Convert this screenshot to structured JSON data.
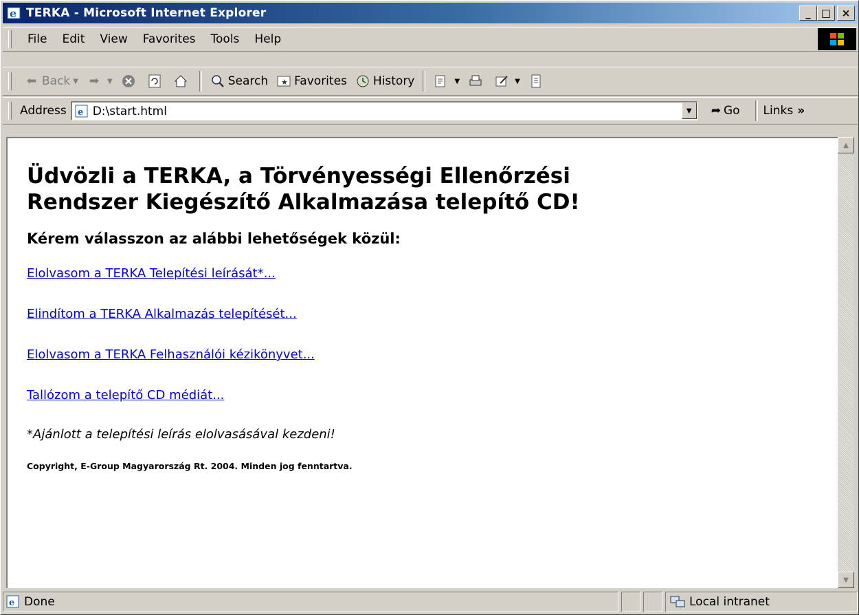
{
  "window": {
    "title": "TERKA - Microsoft Internet Explorer",
    "buttons": {
      "minimize": "_",
      "maximize": "□",
      "close": "×"
    }
  },
  "menu": {
    "items": [
      {
        "label": "File"
      },
      {
        "label": "Edit"
      },
      {
        "label": "View"
      },
      {
        "label": "Favorites"
      },
      {
        "label": "Tools"
      },
      {
        "label": "Help"
      }
    ]
  },
  "toolbar": {
    "back": "Back",
    "search": "Search",
    "favorites": "Favorites",
    "history": "History"
  },
  "address": {
    "label": "Address",
    "value": "D:\\start.html",
    "go": "Go",
    "links": "Links"
  },
  "page": {
    "heading": "Üdvözli a TERKA, a Törvényességi Ellenőrzési Rendszer Kiegészítő Alkalmazása telepítő CD!",
    "subheading": "Kérem válasszon az alábbi lehetőségek közül:",
    "links": [
      "Elolvasom a TERKA Telepítési leírását*...",
      "Elindítom a TERKA Alkalmazás telepítését...",
      "Elolvasom a TERKA Felhasználói kézikönyvet...",
      "Tallózom a telepítő CD médiát..."
    ],
    "note": "*Ajánlott a telepítési leírás elolvasásával kezdeni!",
    "copyright": "Copyright, E-Group Magyarország Rt. 2004. Minden jog fenntartva."
  },
  "status": {
    "text": "Done",
    "zone": "Local intranet"
  },
  "colors": {
    "title_gradient_start": "#0a246a",
    "title_gradient_end": "#a6caf0",
    "link": "#0000ee",
    "chrome": "#d4d0c8"
  }
}
